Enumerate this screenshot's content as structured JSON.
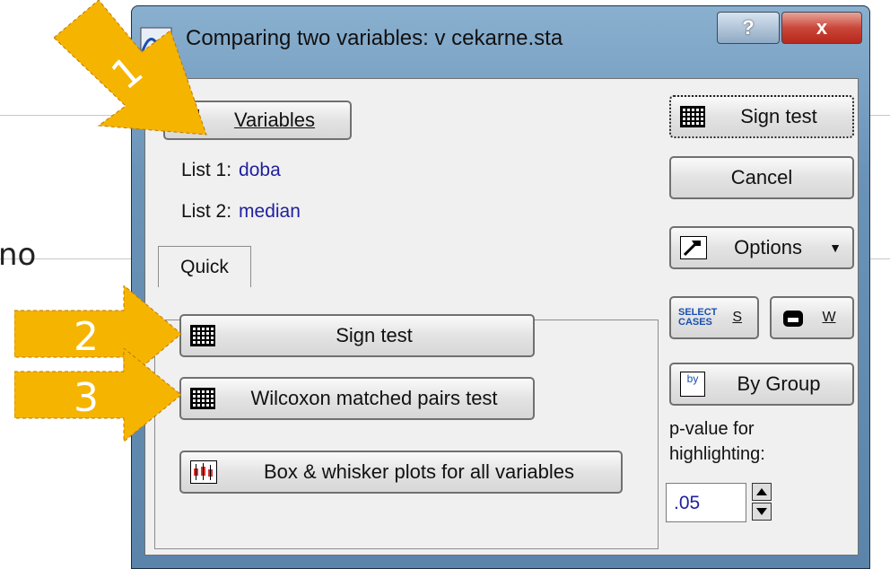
{
  "background": {
    "partial_text": "no"
  },
  "window": {
    "title": "Comparing two variables: v cekarne.sta",
    "help_label": "?",
    "close_label": "x"
  },
  "buttons": {
    "variables": "Variables",
    "sign_test_top": "Sign test",
    "cancel": "Cancel",
    "options": "Options",
    "select_cases_s": "S",
    "weight_w": "W",
    "by_group": "By Group"
  },
  "lists": {
    "list1_label": "List 1:",
    "list1_value": "doba",
    "list2_label": "List 2:",
    "list2_value": "median"
  },
  "tabs": {
    "quick": "Quick"
  },
  "quick": {
    "sign_test": "Sign test",
    "wilcoxon": "Wilcoxon matched pairs test",
    "box_whisker": "Box & whisker plots for all variables"
  },
  "pvalue": {
    "label_line1": "p-value for",
    "label_line2": "highlighting:",
    "value": ".05"
  },
  "icons": {
    "select_cases_line1": "SELECT",
    "select_cases_line2": "CASES",
    "by_group": "by"
  },
  "annotations": {
    "arrow1": "1",
    "arrow2": "2",
    "arrow3": "3",
    "color": "#f5b400"
  }
}
